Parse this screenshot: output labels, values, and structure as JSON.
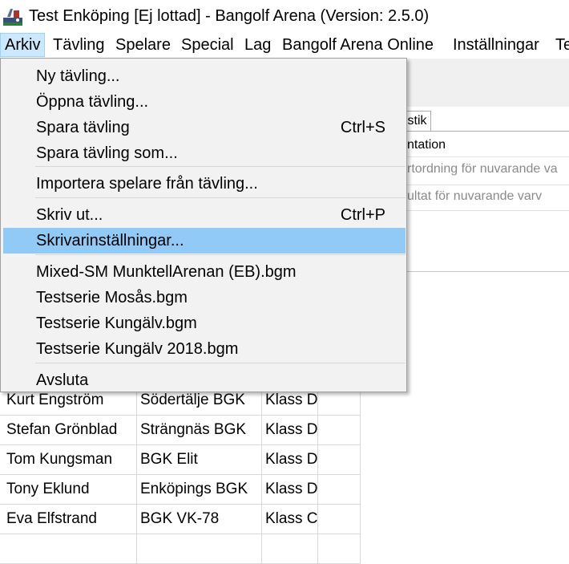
{
  "window": {
    "title": "Test Enköping [Ej lottad] - Bangolf Arena (Version: 2.5.0)",
    "app_icon": "bangolf-arena-icon"
  },
  "menubar": {
    "items": [
      {
        "label": "Arkiv",
        "active": true
      },
      {
        "label": "Tävling"
      },
      {
        "label": "Spelare"
      },
      {
        "label": "Special"
      },
      {
        "label": "Lag"
      },
      {
        "label": "Bangolf Arena Online"
      },
      {
        "label": "Inställningar"
      },
      {
        "label": "Te"
      }
    ]
  },
  "background": {
    "tab_label": "istik",
    "presentation_label": "ntation",
    "rows": [
      "rtordning för nuvarande va",
      "ultat för nuvarande varv"
    ]
  },
  "players": {
    "rows": [
      {
        "name": "Kurt Engström",
        "club": "Södertälje BGK",
        "class": "Klass D"
      },
      {
        "name": "Stefan Grönblad",
        "club": "Strängnäs BGK",
        "class": "Klass D"
      },
      {
        "name": "Tom Kungsman",
        "club": "BGK Elit",
        "class": "Klass D"
      },
      {
        "name": "Tony Eklund",
        "club": "Enköpings BGK",
        "class": "Klass D"
      },
      {
        "name": "Eva Elfstrand",
        "club": "BGK VK-78",
        "class": "Klass C"
      }
    ]
  },
  "arkiv_menu": {
    "items": [
      {
        "label": "Ny tävling...",
        "shortcut": ""
      },
      {
        "label": "Öppna tävling...",
        "shortcut": ""
      },
      {
        "label": "Spara tävling",
        "shortcut": "Ctrl+S"
      },
      {
        "label": "Spara tävling som...",
        "shortcut": ""
      },
      {
        "label": "Importera spelare från tävling...",
        "shortcut": ""
      },
      {
        "label": "Skriv ut...",
        "shortcut": "Ctrl+P"
      },
      {
        "label": "Skrivarinställningar...",
        "shortcut": "",
        "highlighted": true
      },
      {
        "label": "Mixed-SM MunktellArenan (EB).bgm",
        "shortcut": ""
      },
      {
        "label": "Testserie Mosås.bgm",
        "shortcut": ""
      },
      {
        "label": "Testserie Kungälv.bgm",
        "shortcut": ""
      },
      {
        "label": "Testserie Kungälv 2018.bgm",
        "shortcut": ""
      },
      {
        "label": "Avsluta",
        "shortcut": ""
      }
    ]
  },
  "colors": {
    "menu_active_bg": "#cce8ff",
    "menu_highlight_bg": "#91c9f7",
    "menu_bg": "#f2f2f2"
  }
}
